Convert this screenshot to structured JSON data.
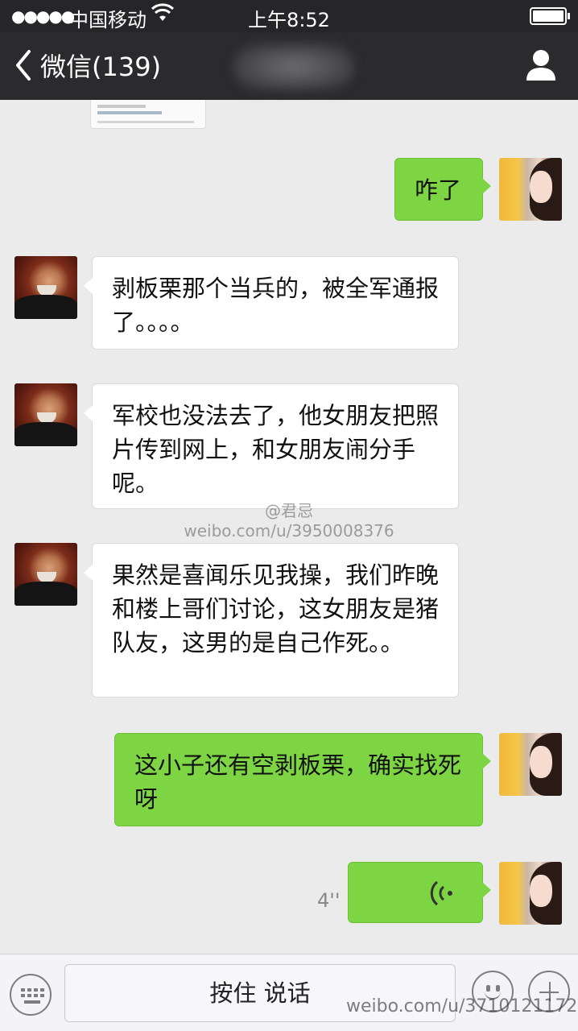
{
  "status_bar": {
    "signal": "●●●●●",
    "carrier": "中国移动",
    "time": "上午8:52"
  },
  "nav": {
    "back_label": "微信(139)"
  },
  "messages": [
    {
      "side": "right",
      "text": "咋了"
    },
    {
      "side": "left",
      "text": "剥板栗那个当兵的，被全军通报了。。。。"
    },
    {
      "side": "left",
      "text": "军校也没法去了，他女朋友把照片传到网上，和女朋友闹分手呢。"
    },
    {
      "side": "left",
      "text": "果然是喜闻乐见我操，我们昨晚和楼上哥们讨论，这女朋友是猪队友，这男的是自己作死。。"
    },
    {
      "side": "right",
      "text": "这小子还有空剥板栗，确实找死呀"
    },
    {
      "side": "right",
      "type": "voice",
      "duration": "4''"
    }
  ],
  "watermark_center": {
    "handle": "@君忌",
    "url": "weibo.com/u/3950008376"
  },
  "watermark_bottom": {
    "url": "weibo.com/u/3710121172"
  },
  "input_bar": {
    "talk_label": "按住 说话"
  },
  "colors": {
    "bubble_green": "#7ed543",
    "bubble_white": "#ffffff",
    "chat_bg": "#ebebeb",
    "navbar_bg": "#2b2b2d"
  },
  "icons": [
    "back-chevron-icon",
    "profile-icon",
    "wifi-icon",
    "battery-icon",
    "voice-wave-icon",
    "keyboard-icon",
    "emoji-icon",
    "plus-icon"
  ]
}
